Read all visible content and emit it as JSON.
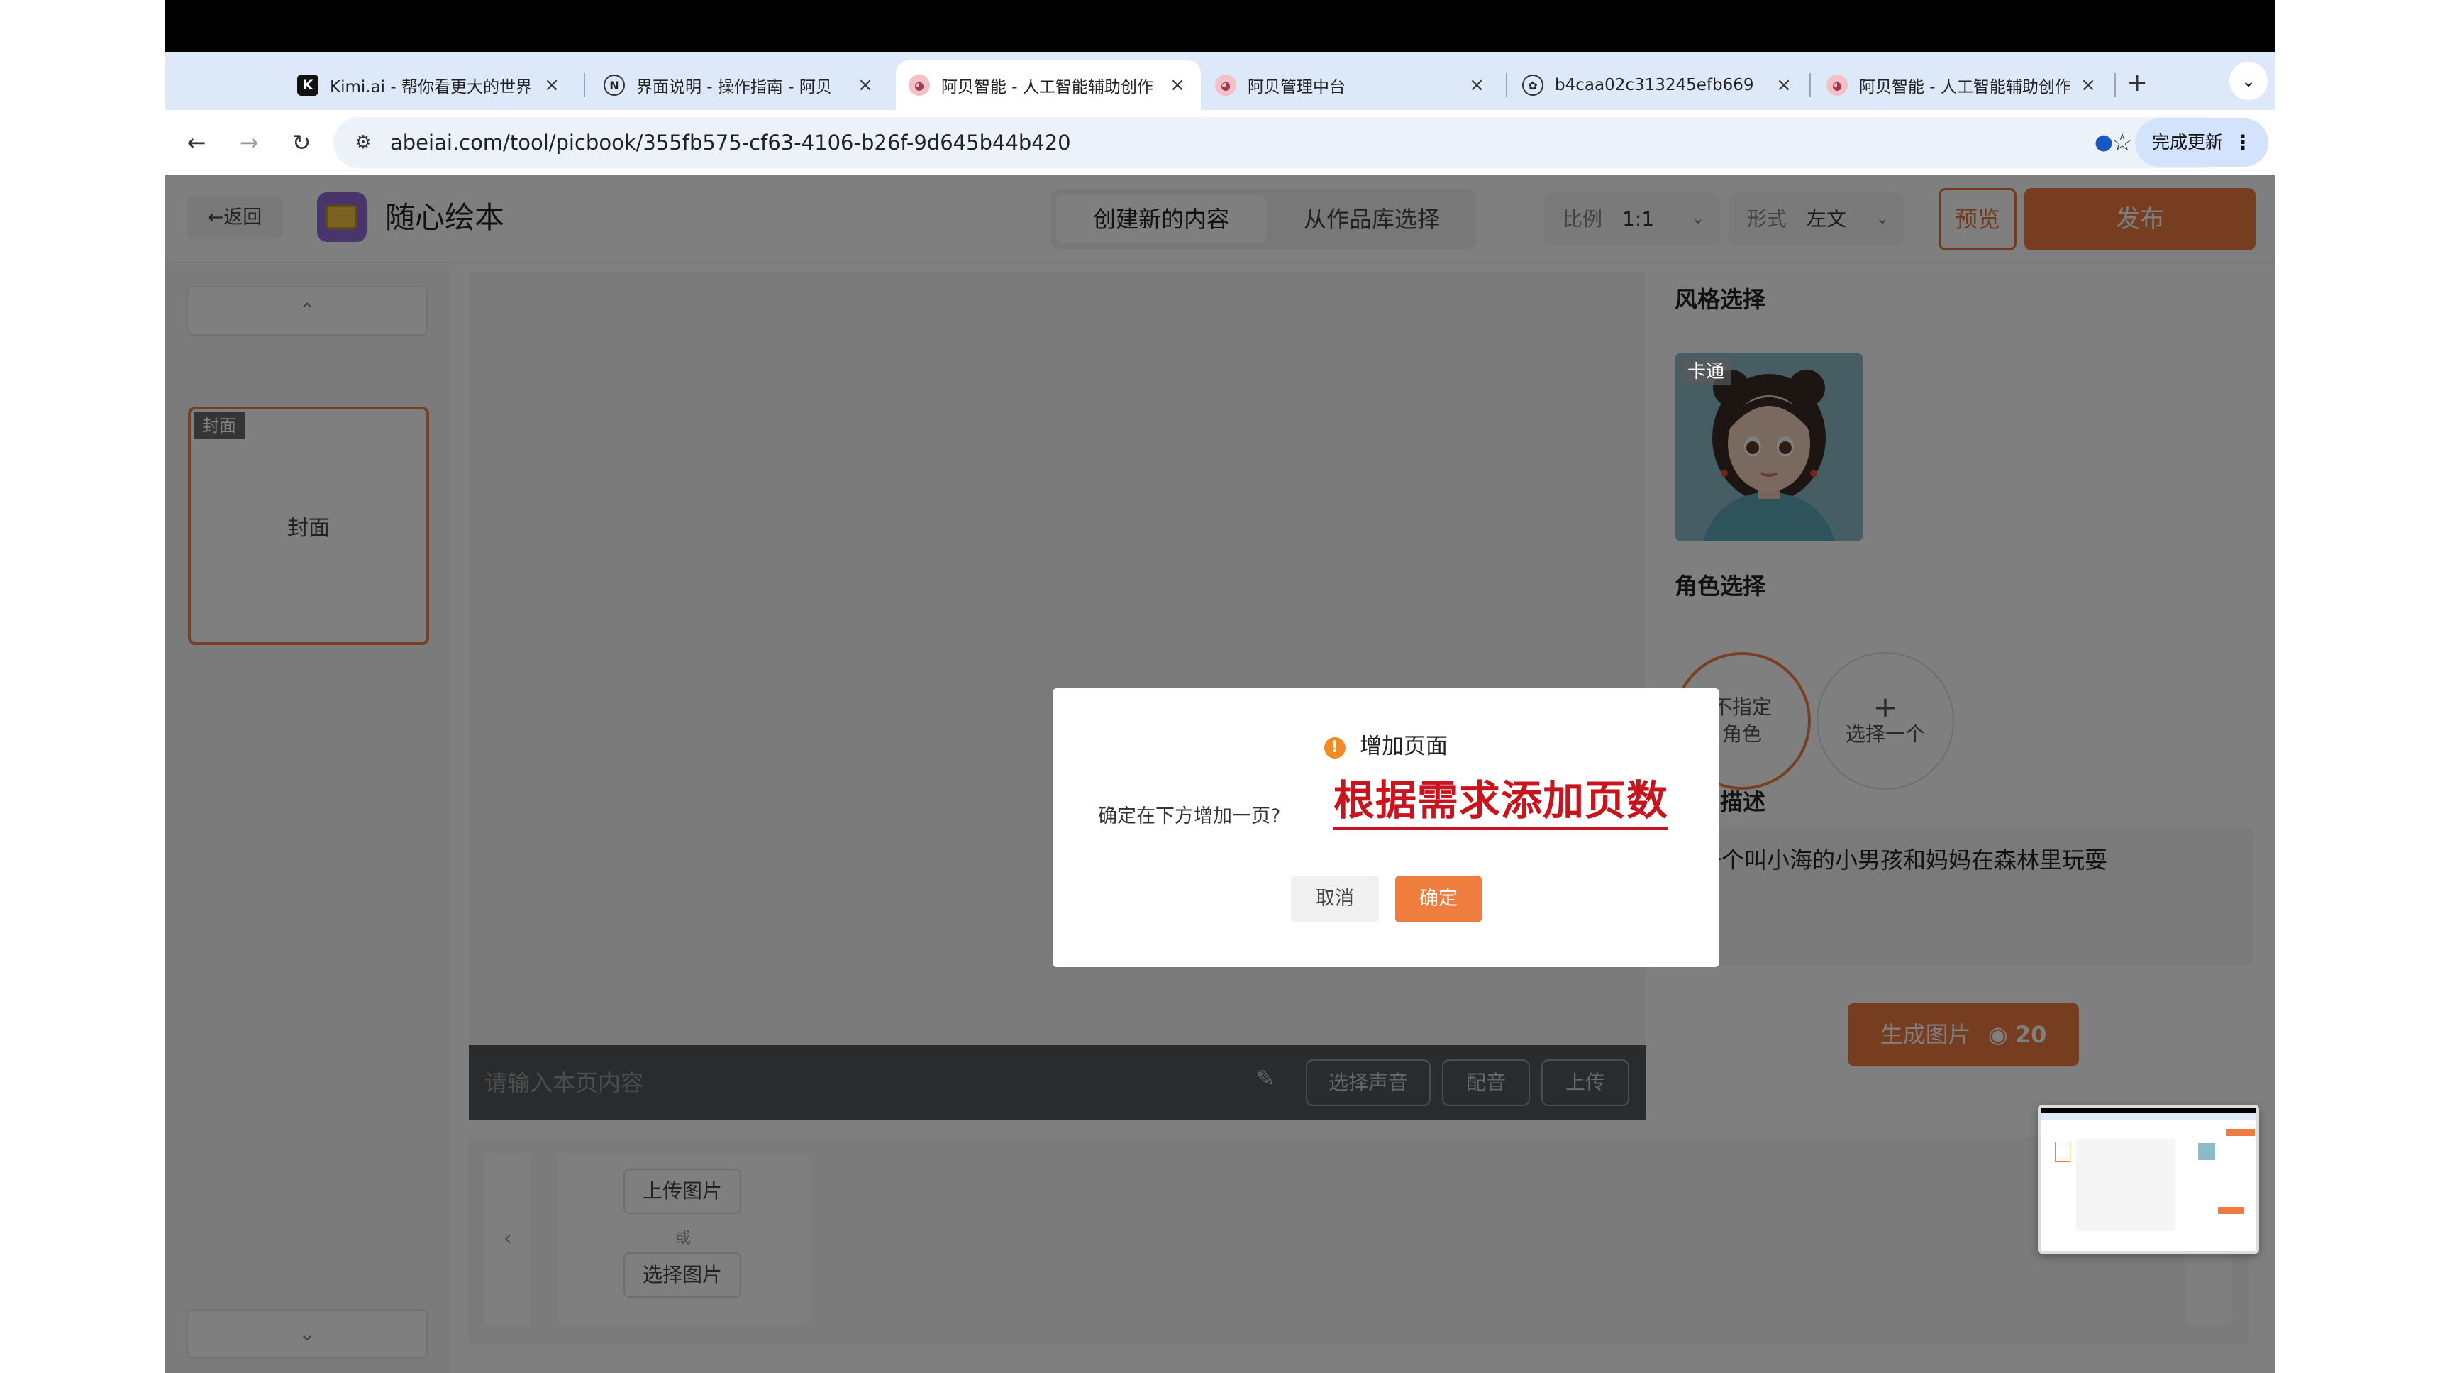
{
  "browser": {
    "tabs": [
      {
        "title": "Kimi.ai - 帮你看更大的世界",
        "icon": "kimi-icon",
        "close": "×"
      },
      {
        "title": "界面说明 - 操作指南 - 阿贝",
        "icon": "notion-icon",
        "close": "×"
      },
      {
        "title": "阿贝智能 - 人工智能辅助创作",
        "icon": "abei-icon",
        "close": "×"
      },
      {
        "title": "阿贝管理中台",
        "icon": "abei-icon",
        "close": "×"
      },
      {
        "title": "b4caa02c313245efb669",
        "icon": "openai-icon",
        "close": "×"
      },
      {
        "title": "阿贝智能 - 人工智能辅助创作",
        "icon": "abei-icon",
        "close": "×"
      }
    ],
    "new_tab": "+",
    "tab_list": "⌄",
    "url": "abeiai.com/tool/picbook/355fb575-cf63-4106-b26f-9d645b44b420",
    "update_label": "完成更新"
  },
  "app": {
    "back_label": "←返回",
    "title": "随心绘本",
    "mode_tabs": [
      "创建新的内容",
      "从作品库选择"
    ],
    "ratio": {
      "label": "比例",
      "value": "1:1"
    },
    "layout": {
      "label": "形式",
      "value": "左文"
    },
    "preview_label": "预览",
    "publish_label": "发布"
  },
  "pages": {
    "cover_tag": "封面",
    "cover_label": "封面"
  },
  "editor": {
    "text_placeholder": "请输入本页内容",
    "buttons": [
      "选择声音",
      "配音",
      "上传"
    ],
    "upload_image": "上传图片",
    "or": "或",
    "select_image": "选择图片"
  },
  "panel": {
    "style_heading": "风格选择",
    "style_tag": "卡通",
    "role_heading": "角色选择",
    "role_unspecified": [
      "不指定",
      "角色"
    ],
    "role_add": [
      "+",
      "选择一个"
    ],
    "desc_heading": "图片描述",
    "desc_text": "一个叫小海的小男孩和妈妈在森林里玩耍",
    "generate_label": "生成图片",
    "generate_cost": "20"
  },
  "dialog": {
    "title": "增加页面",
    "message": "确定在下方增加一页?",
    "annotation": "根据需求添加页数",
    "cancel": "取消",
    "confirm": "确定"
  },
  "colors": {
    "accent": "#ee7b42",
    "annotation": "#c8141c",
    "tabstrip": "#dde8f9"
  }
}
